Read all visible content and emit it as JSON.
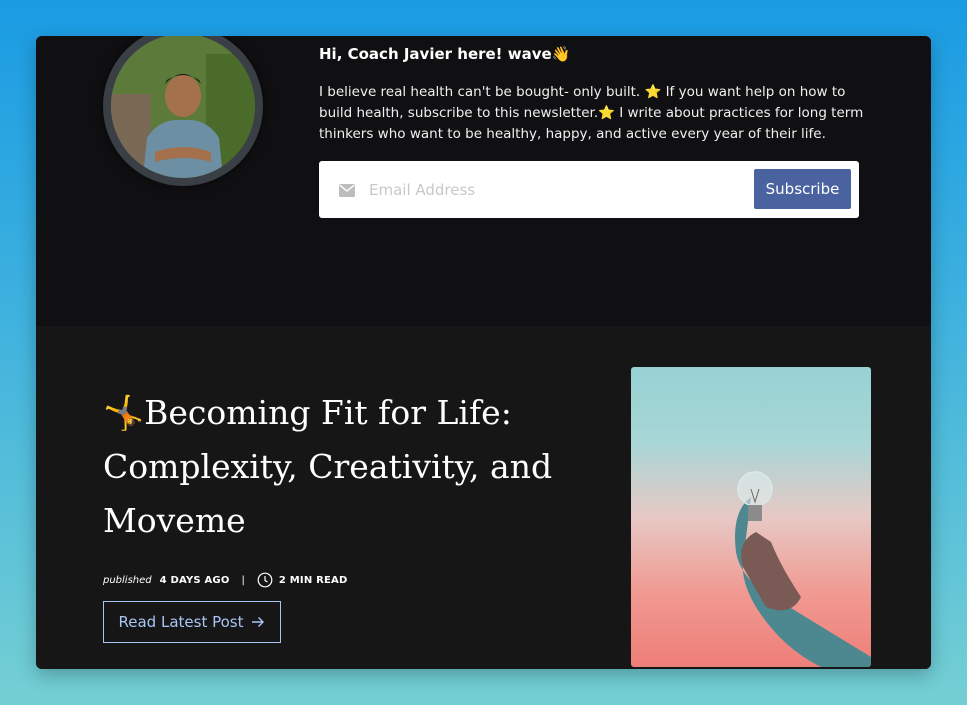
{
  "newsletter": {
    "greeting": "Hi, Coach Javier here! wave👋",
    "bio": "I believe real health can't be bought- only built. ⭐ If you want help on how to build health, subscribe to this newsletter.⭐ I write about practices for long term thinkers who want to be healthy, happy, and active every year of their life.",
    "email_placeholder": "Email Address",
    "email_value": "",
    "subscribe_label": "Subscribe",
    "icon": "envelope-icon"
  },
  "latest_post": {
    "title": "🤸Becoming Fit for Life: Complexity, Creativity, and Moveme",
    "published_label": "published",
    "published_ago": "4 DAYS AGO",
    "separator": "|",
    "read_time": "2 MIN READ",
    "button_label": "Read Latest Post",
    "icons": [
      "clock-icon",
      "arrow-right-icon"
    ]
  },
  "colors": {
    "card_bg": "#121213",
    "accent_button": "#4a63a0",
    "link_blue": "#a9c5f5"
  }
}
